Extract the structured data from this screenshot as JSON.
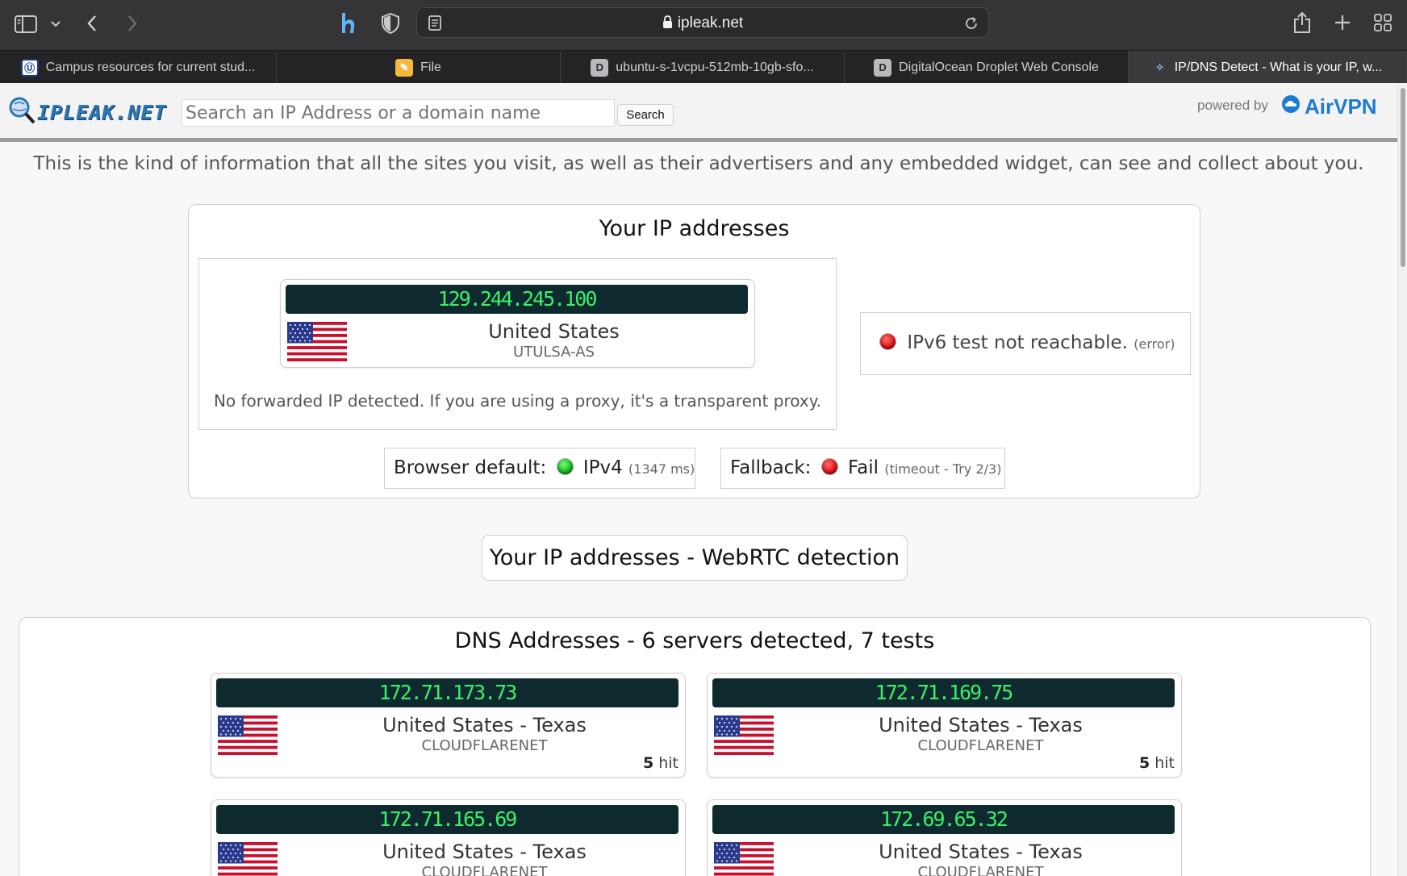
{
  "browser": {
    "url": "ipleak.net",
    "tabs": [
      {
        "label": "Campus resources for current stud...",
        "favicon": "tu-shield-icon",
        "active": false
      },
      {
        "label": "File",
        "favicon": "pencil-doc-icon",
        "active": false
      },
      {
        "label": "ubuntu-s-1vcpu-512mb-10gb-sfo...",
        "favicon": "d-letter-icon",
        "active": false
      },
      {
        "label": "DigitalOcean Droplet Web Console",
        "favicon": "d-letter-icon",
        "active": false
      },
      {
        "label": "IP/DNS Detect - What is your IP, w...",
        "favicon": "ipleak-icon",
        "active": true
      }
    ]
  },
  "header": {
    "logo_text": "IPLEAK.NET",
    "search_placeholder": "Search an IP Address or a domain name",
    "search_button": "Search",
    "powered_by": "powered by",
    "brand": "AirVPN"
  },
  "intro": "This is the kind of information that all the sites you visit, as well as their advertisers and any embedded widget, can see and collect about you.",
  "ip_section": {
    "title": "Your IP addresses",
    "ipv4": {
      "ip": "129.244.245.100",
      "country": "United States",
      "isp": "UTULSA-AS"
    },
    "forwarded_note": "No forwarded IP detected. If you are using a proxy, it's a transparent proxy.",
    "ipv6": {
      "text": "IPv6 test not reachable.",
      "note": "(error)"
    },
    "browser_default": {
      "label": "Browser default:",
      "value": "IPv4",
      "detail": "(1347 ms)"
    },
    "fallback": {
      "label": "Fallback:",
      "value": "Fail",
      "detail": "(timeout - Try 2/3)"
    }
  },
  "webrtc": {
    "title": "Your IP addresses - WebRTC detection"
  },
  "dns": {
    "title": "DNS Addresses - 6 servers detected, 7 tests",
    "hit_suffix": "hit",
    "servers": [
      {
        "ip": "172.71.173.73",
        "country": "United States - Texas",
        "isp": "CLOUDFLARENET",
        "hits": "5"
      },
      {
        "ip": "172.71.169.75",
        "country": "United States - Texas",
        "isp": "CLOUDFLARENET",
        "hits": "5"
      },
      {
        "ip": "172.71.165.69",
        "country": "United States - Texas",
        "isp": "CLOUDFLARENET",
        "hits": ""
      },
      {
        "ip": "172.69.65.32",
        "country": "United States - Texas",
        "isp": "CLOUDFLARENET",
        "hits": ""
      }
    ]
  },
  "colors": {
    "ip_green": "#3af06a",
    "ip_bar": "#0e2a2e",
    "status_green": "#11b824",
    "status_red": "#e01010",
    "brand_blue": "#1e7bd3"
  }
}
